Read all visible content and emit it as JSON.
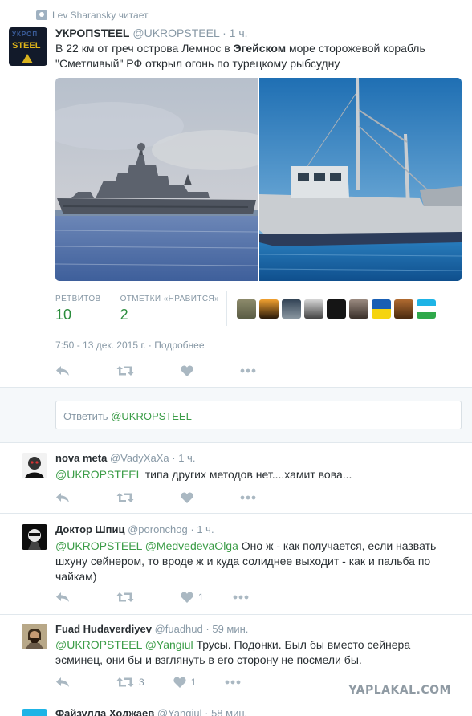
{
  "context": {
    "text": "Lev Sharansky читает"
  },
  "main": {
    "name": "УКРОПSTEEL",
    "handle": "@UKROPSTEEL",
    "sep": "·",
    "time": "1 ч.",
    "avatar_text_top": "УКРОП",
    "avatar_text_bottom": "STEEL",
    "text_1": "В 22 км от греч острова Лемнос в ",
    "text_bold": "Эгейском",
    "text_2": " море сторожевой корабль \"Сметливый\" РФ открыл огонь по турецкому рыбсудну",
    "stats": {
      "retweets_label": "РЕТВИТОВ",
      "retweets_value": "10",
      "likes_label": "ОТМЕТКИ «НРАВИТСЯ»",
      "likes_value": "2"
    },
    "timestamp": "7:50 - 13 дек. 2015 г.",
    "details_link": "Подробнее"
  },
  "reply_box": {
    "prefix": "Ответить ",
    "mention": "@UKROPSTEEL"
  },
  "replies": [
    {
      "name": "nova meta",
      "handle": "@VadyXaXa",
      "time": "1 ч.",
      "mention": "@UKROPSTEEL",
      "text": " типа других методов нет....хамит вова...",
      "likes": ""
    },
    {
      "name": "Доктор Шпиц",
      "handle": "@poronchog",
      "time": "1 ч.",
      "mention": "@UKROPSTEEL @MedvedevaOlga",
      "text": " Оно ж - как получается, если назвать шхуну сейнером, то вроде ж и куда солиднее выходит - как и пальба по чайкам)",
      "likes": "1"
    },
    {
      "name": "Fuad Hudaverdiyev",
      "handle": "@fuadhud",
      "time": "59 мин.",
      "mention": "@UKROPSTEEL @Yangiul",
      "text": " Трусы. Подонки. Был бы вместо сейнера эсминец, они бы и взглянуть в его сторону не посмели бы.",
      "retweets": "3",
      "likes": "1"
    },
    {
      "name": "Файзулла Ходжаев",
      "handle": "@Yangiul",
      "time": "58 мин."
    }
  ],
  "watermark": "YAPLAKAL.COM",
  "colors": {
    "link": "#3b94d9",
    "stat": "#2a8c3c",
    "muted": "#8899a6",
    "icon": "#aab8c2"
  },
  "icons": [
    "user-icon",
    "reply-icon",
    "retweet-icon",
    "heart-icon",
    "more-icon"
  ]
}
